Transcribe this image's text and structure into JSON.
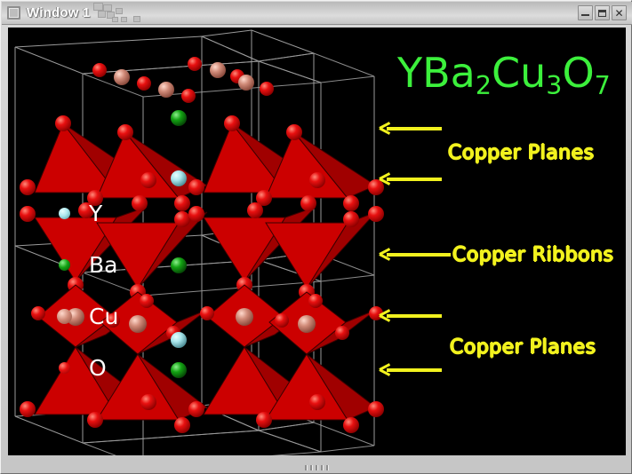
{
  "window": {
    "title": "Window 1",
    "icon": "window-icon",
    "buttons": [
      {
        "name": "minimize",
        "glyph": "minimize-icon"
      },
      {
        "name": "maximize",
        "glyph": "maximize-icon"
      },
      {
        "name": "close",
        "glyph": "close-icon",
        "label": "✕"
      }
    ]
  },
  "colors": {
    "background": "#000000",
    "formula": "#3cf03c",
    "annotation": "#f2f21e",
    "legend_text": "#ffffff",
    "cell_wireframe": "#a0a0a0",
    "y_atom": "#a8e6ec",
    "ba_atom": "#13a313",
    "cu_atom": "#d08a78",
    "o_atom": "#e00000",
    "polyhedron": "#cc0000"
  },
  "formula": {
    "parts": [
      {
        "text": "YBa",
        "sub": false
      },
      {
        "text": "2",
        "sub": true
      },
      {
        "text": "Cu",
        "sub": false
      },
      {
        "text": "3",
        "sub": true
      },
      {
        "text": "O",
        "sub": false
      },
      {
        "text": "7",
        "sub": true
      }
    ],
    "plain": "YBa2Cu3O7"
  },
  "legend": {
    "items": [
      {
        "label": "Y",
        "color": "#a8e6ec",
        "size": "sm"
      },
      {
        "label": "Ba",
        "color": "#13a313",
        "size": "sm"
      },
      {
        "label": "Cu",
        "color": "#d08a78",
        "size": "md"
      },
      {
        "label": "O",
        "color": "#e00000",
        "size": "sm"
      }
    ]
  },
  "annotations": [
    {
      "text": "Copper  Planes",
      "arrows": 2,
      "id": "copper-planes-top"
    },
    {
      "text": "Copper  Ribbons",
      "arrows": 1,
      "id": "copper-ribbons"
    },
    {
      "text": "Copper  Planes",
      "arrows": 2,
      "id": "copper-planes-bottom"
    }
  ],
  "structure": {
    "description": "YBa2Cu3O7 unit cell, CuO5 pyramids and CuO4 ribbons",
    "layers": [
      {
        "type": "cu-o-chain",
        "label": "Copper Ribbons"
      },
      {
        "type": "cuo5-pyramid-up",
        "label": "Copper Planes"
      },
      {
        "type": "ba",
        "label": "Ba"
      },
      {
        "type": "y",
        "label": "Y"
      }
    ]
  }
}
